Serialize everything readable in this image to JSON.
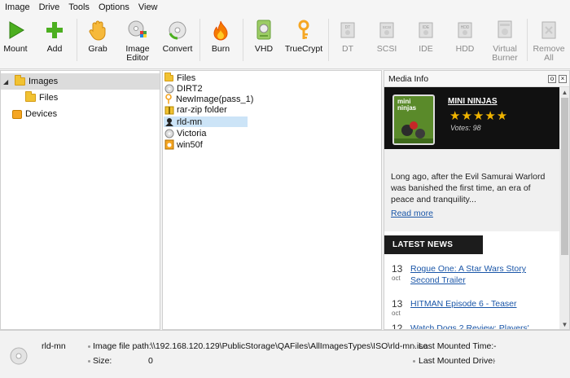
{
  "menu": [
    "Image",
    "Drive",
    "Tools",
    "Options",
    "View"
  ],
  "toolbar": {
    "mount": "Mount",
    "add": "Add",
    "grab": "Grab",
    "image_editor": "Image\nEditor",
    "convert": "Convert",
    "burn": "Burn",
    "vhd": "VHD",
    "truecrypt": "TrueCrypt",
    "dt": "DT",
    "scsi": "SCSI",
    "ide": "IDE",
    "hdd": "HDD",
    "virtual_burner": "Virtual\nBurner",
    "remove_all": "Remove\nAll"
  },
  "tree": {
    "images": "Images",
    "files": "Files",
    "devices": "Devices"
  },
  "files": [
    {
      "name": "Files",
      "icon": "folder-icon"
    },
    {
      "name": "DIRT2",
      "icon": "disc-icon"
    },
    {
      "name": "NewImage(pass_1)",
      "icon": "key-icon"
    },
    {
      "name": "rar-zip folder",
      "icon": "archive-icon"
    },
    {
      "name": "rld-mn",
      "icon": "ninja-icon"
    },
    {
      "name": "Victoria",
      "icon": "disc-icon"
    },
    {
      "name": "win50f",
      "icon": "image-icon"
    }
  ],
  "media": {
    "header": "Media Info",
    "game_title": "MINI NINJAS",
    "cover_text": "mini ninjas",
    "stars": "★★★★★",
    "votes": "Votes: 98",
    "description": "Long ago, after the Evil Samurai Warlord was banished the first time, an era of peace and tranquility...",
    "read_more": "Read more",
    "latest_news": "LATEST NEWS",
    "news": [
      {
        "day": "13",
        "month": "oct",
        "title": "Rogue One: A Star Wars Story Second Trailer"
      },
      {
        "day": "13",
        "month": "oct",
        "title": "HITMAN Episode 6 - Teaser"
      },
      {
        "day": "12",
        "month": "",
        "title": "Watch Dogs 2 Review: Players'"
      }
    ]
  },
  "status": {
    "name": "rld-mn",
    "path_label": "Image file path:",
    "path_value": "\\\\192.168.120.129\\PublicStorage\\QAFiles\\AllImagesTypes\\ISO\\rld-mn.iso",
    "size_label": "Size:",
    "size_value": "0",
    "last_time_label": "Last Mounted Time:",
    "last_time_value": "-",
    "last_drive_label": "Last Mounted Drive:",
    "last_drive_value": "-"
  },
  "colors": {
    "accent_green": "#4caf20",
    "selection": "#cce4f7",
    "link": "#1a56a8",
    "star": "#f0b400"
  }
}
